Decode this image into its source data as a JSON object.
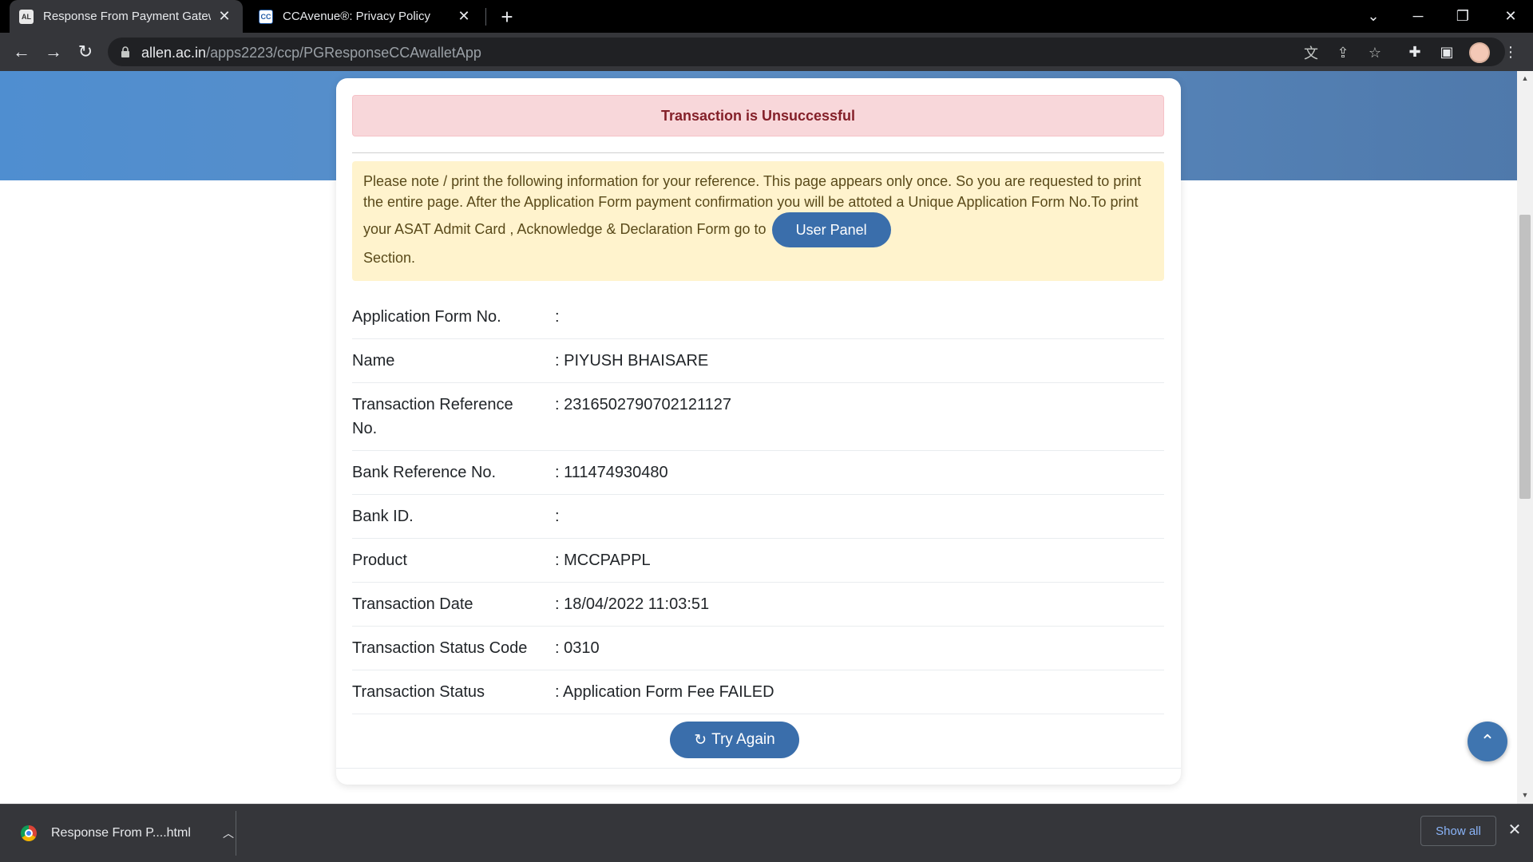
{
  "browser": {
    "tabs": [
      {
        "title": "Response From Payment Gatewa",
        "favicon": "allen-favicon",
        "active": true
      },
      {
        "title": "CCAvenue®: Privacy Policy",
        "favicon": "ccavenue-favicon",
        "active": false
      }
    ],
    "url_host": "allen.ac.in",
    "url_path": "/apps2223/ccp/PGResponseCCAwalletApp"
  },
  "page": {
    "alert_title": "Transaction is Unsuccessful",
    "note_text": "Please note / print the following information for your reference. This page appears only once. So you are requested to print the entire page. After the Application Form payment confirmation you will be attoted a Unique Application Form No.To print your ASAT Admit Card , Acknowledge & Declaration Form go to",
    "user_panel_label": "User Panel",
    "note_suffix": "Section.",
    "rows": [
      {
        "label": "Application Form No.",
        "value": ":"
      },
      {
        "label": "Name",
        "value": ": PIYUSH BHAISARE"
      },
      {
        "label": "Transaction Reference No.",
        "value": ": 2316502790702121127"
      },
      {
        "label": "Bank Reference No.",
        "value": ": 111474930480"
      },
      {
        "label": "Bank ID.",
        "value": ":"
      },
      {
        "label": "Product",
        "value": ": MCCPAPPL"
      },
      {
        "label": "Transaction Date",
        "value": ": 18/04/2022 11:03:51"
      },
      {
        "label": "Transaction Status Code",
        "value": ": 0310"
      },
      {
        "label": "Transaction Status",
        "value": ": Application Form Fee FAILED"
      }
    ],
    "try_again_label": "Try Again"
  },
  "downloads": {
    "file_name": "Response From P....html",
    "show_all_label": "Show all"
  },
  "colors": {
    "accent": "#3a6eab",
    "danger_bg": "#f8d7da",
    "danger_text": "#842029",
    "warning_bg": "#fff3cd"
  }
}
